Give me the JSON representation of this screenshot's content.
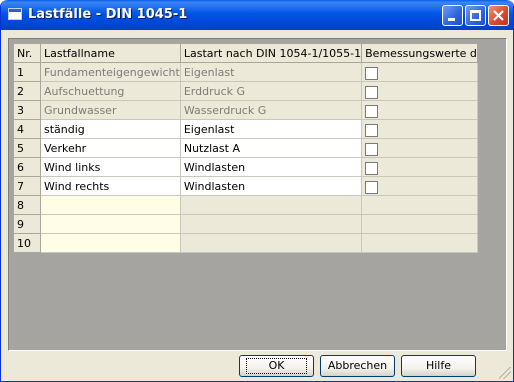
{
  "window": {
    "title": "Lastfälle - DIN 1045-1"
  },
  "table": {
    "headers": [
      "Nr.",
      "Lastfallname",
      "Lastart nach DIN 1054-1/1055-1",
      "Bemessungswerte d"
    ],
    "rows": [
      {
        "nr": "1",
        "name": "Fundamenteigengewicht",
        "art": "Eigenlast",
        "checkbox": true
      },
      {
        "nr": "2",
        "name": "Aufschuettung",
        "art": "Erddruck G",
        "checkbox": true
      },
      {
        "nr": "3",
        "name": "Grundwasser",
        "art": "Wasserdruck G",
        "checkbox": true
      },
      {
        "nr": "4",
        "name": "ständig",
        "art": "Eigenlast",
        "checkbox": true
      },
      {
        "nr": "5",
        "name": "Verkehr",
        "art": "Nutzlast A",
        "checkbox": true
      },
      {
        "nr": "6",
        "name": "Wind links",
        "art": "Windlasten",
        "checkbox": true
      },
      {
        "nr": "7",
        "name": "Wind rechts",
        "art": "Windlasten",
        "checkbox": true
      },
      {
        "nr": "8",
        "name": "",
        "art": "",
        "checkbox": false
      },
      {
        "nr": "9",
        "name": "",
        "art": "",
        "checkbox": false
      },
      {
        "nr": "10",
        "name": "",
        "art": "",
        "checkbox": false
      }
    ]
  },
  "buttons": {
    "ok": "OK",
    "cancel": "Abbrechen",
    "help": "Hilfe"
  }
}
